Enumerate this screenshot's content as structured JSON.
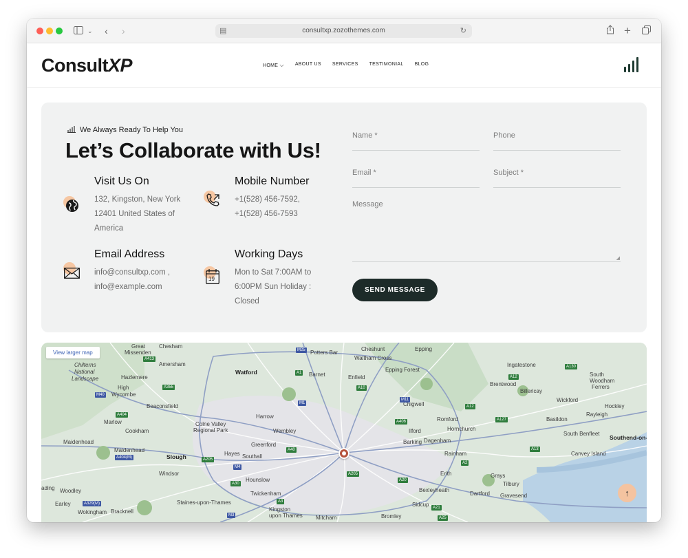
{
  "browser": {
    "url": "consultxp.zozothemes.com",
    "icons": {
      "sidebar": "sidebar-icon",
      "back": "chevron-left-icon",
      "forward": "chevron-right-icon",
      "share": "share-icon",
      "new_tab": "plus-icon",
      "tabs": "tabs-icon",
      "reload": "reload-icon"
    }
  },
  "header": {
    "logo_main": "Consult",
    "logo_accent": "XP",
    "nav": [
      "HOME",
      "ABOUT US",
      "SERVICES",
      "TESTIMONIAL",
      "BLOG"
    ],
    "accent_color": "#1e3a31"
  },
  "contact": {
    "tagline": "We Always Ready To Help You",
    "title": "Let’s Collaborate with Us!",
    "info": [
      {
        "title": "Visit Us On",
        "lines": [
          "132, Kingston, New York",
          "12401 United States of",
          "America"
        ],
        "icon": "globe-icon"
      },
      {
        "title": "Mobile Number",
        "lines": [
          "+1(528) 456-7592,",
          "+1(528) 456-7593"
        ],
        "icon": "phone-icon"
      },
      {
        "title": "Email Address",
        "lines": [
          "info@consultxp.com ,",
          "info@example.com"
        ],
        "icon": "envelope-icon"
      },
      {
        "title": "Working Days",
        "lines": [
          "Mon to Sat 7:00AM to",
          "6:00PM Sun Holiday :",
          "Closed"
        ],
        "icon": "calendar-icon",
        "calendar_day": "19"
      }
    ],
    "form": {
      "name_placeholder": "Name *",
      "phone_placeholder": "Phone",
      "email_placeholder": "Email *",
      "subject_placeholder": "Subject *",
      "message_placeholder": "Message",
      "submit_label": "SEND MESSAGE"
    }
  },
  "map": {
    "view_larger": "View larger map",
    "places": [
      "Great",
      "Chesham",
      "Missenden",
      "Amersham",
      "Chilterns",
      "National",
      "Landscape",
      "Hazlemere",
      "High",
      "Wycombe",
      "Beaconsfield",
      "Marlow",
      "Cookham",
      "Maidenhead",
      "Slough",
      "Windsor",
      "Maidenhead",
      "ading",
      "Woodley",
      "Earley",
      "Wokingham",
      "Bracknell",
      "Watford",
      "Potters Bar",
      "Barnet",
      "Enfield",
      "Cheshunt",
      "Waltham Cross",
      "Epping",
      "Epping Forest",
      "Harrow",
      "Colne Valley",
      "Regional Park",
      "Wembley",
      "Greenford",
      "Hayes",
      "Southall",
      "Hounslow",
      "Twickenham",
      "Staines-upon-Thames",
      "Kingston",
      "upon Thames",
      "Mitcham",
      "Chigwell",
      "Romford",
      "Ilford",
      "Barking",
      "Dagenham",
      "Hornchurch",
      "Rainham",
      "Erith",
      "Dartford",
      "Bexleyheath",
      "Sidcup",
      "Bromley",
      "Grays",
      "Tilbury",
      "Gravesend",
      "Brentwood",
      "Ingatestone",
      "Billericay",
      "Wickford",
      "Basildon",
      "Rayleigh",
      "Hockley",
      "South",
      "Woodham",
      "Ferrers",
      "South Benfleet",
      "Southend-on-",
      "Canvey Island",
      "Hornchurch"
    ],
    "roads": [
      "M25",
      "M1",
      "A1",
      "A10",
      "M11",
      "A12",
      "A127",
      "A13",
      "A130",
      "M40",
      "A413",
      "A355",
      "A404",
      "A404(M)",
      "M4",
      "A329(M)",
      "M3",
      "A3",
      "A30",
      "A40",
      "A406",
      "A2",
      "A20",
      "A21",
      "A25",
      "A205",
      "A205",
      "A12"
    ]
  },
  "scroll_top_icon": "arrow-up-icon"
}
